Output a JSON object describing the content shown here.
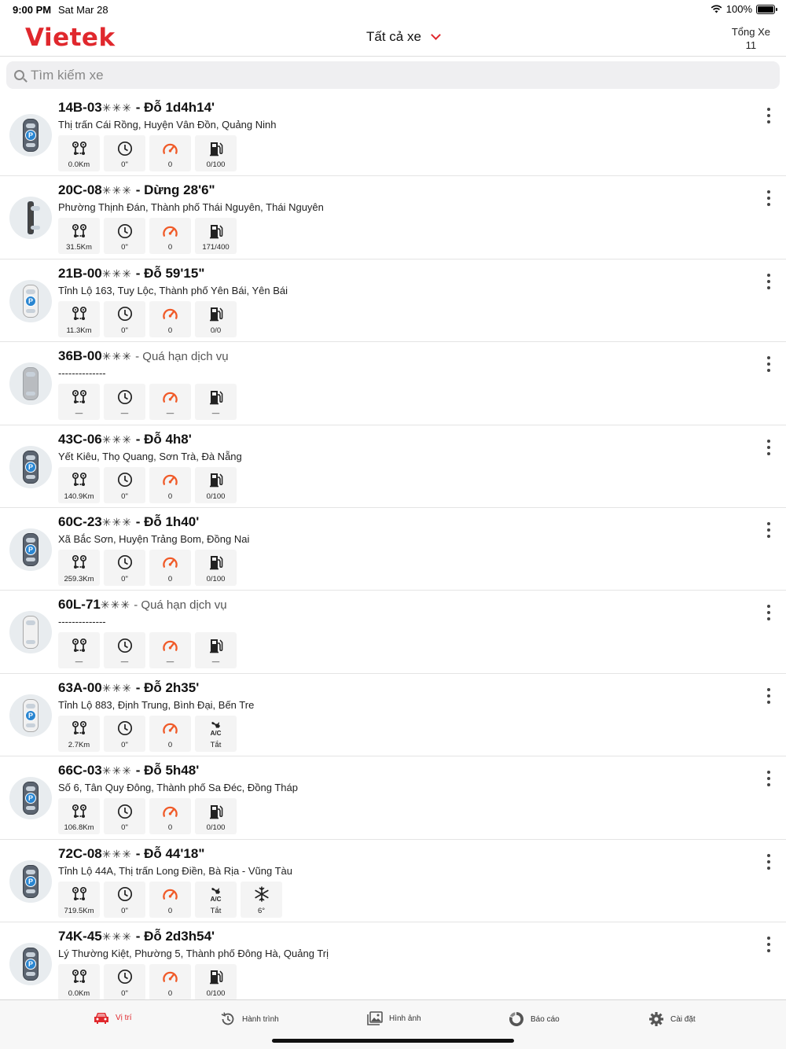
{
  "status_bar": {
    "time": "9:00 PM",
    "date": "Sat Mar 28",
    "battery": "100%"
  },
  "header": {
    "logo": "Vietek",
    "filter_label": "Tất cả xe",
    "total_label": "Tổng Xe",
    "total_count": "11"
  },
  "search": {
    "placeholder": "Tìm kiếm xe"
  },
  "vehicles": [
    {
      "plate": "14B-03",
      "stars": "✳✳✳",
      "status": " - Đỗ 1d4h14'",
      "address": "Thị trấn Cái Rồng, Huyện Vân Đồn, Quảng Ninh",
      "distance": "0.0Km",
      "time": "0\"",
      "speed": "0",
      "fourth": "0/100"
    },
    {
      "plate": "20C-08",
      "stars": "✳✳✳",
      "status": " - Dừng 28'6\"",
      "address": "Phường Thịnh Đán, Thành phố Thái Nguyên, Thái Nguyên",
      "distance": "31.5Km",
      "time": "0\"",
      "speed": "0",
      "fourth": "171/400"
    },
    {
      "plate": "21B-00",
      "stars": "✳✳✳",
      "status": " - Đỗ 59'15\"",
      "address": "Tỉnh Lộ 163, Tuy Lộc, Thành phố Yên Bái, Yên Bái",
      "distance": "11.3Km",
      "time": "0\"",
      "speed": "0",
      "fourth": "0/0"
    },
    {
      "plate": "36B-00",
      "stars": "✳✳✳",
      "status": " - Quá hạn dịch vụ",
      "address": "--------------",
      "distance": "—",
      "time": "—",
      "speed": "—",
      "fourth": "—"
    },
    {
      "plate": "43C-06",
      "stars": "✳✳✳",
      "status": " - Đỗ 4h8'",
      "address": "Yết Kiêu, Thọ Quang, Sơn Trà, Đà Nẵng",
      "distance": "140.9Km",
      "time": "0\"",
      "speed": "0",
      "fourth": "0/100"
    },
    {
      "plate": "60C-23",
      "stars": "✳✳✳",
      "status": " - Đỗ 1h40'",
      "address": "Xã Bắc Sơn, Huyện Trảng Bom, Đồng Nai",
      "distance": "259.3Km",
      "time": "0\"",
      "speed": "0",
      "fourth": "0/100"
    },
    {
      "plate": "60L-71",
      "stars": "✳✳✳",
      "status": " - Quá hạn dịch vụ",
      "address": "--------------",
      "distance": "—",
      "time": "—",
      "speed": "—",
      "fourth": "—"
    },
    {
      "plate": "63A-00",
      "stars": "✳✳✳",
      "status": " - Đỗ 2h35'",
      "address": "Tỉnh Lộ 883, Định Trung, Bình Đại, Bến Tre",
      "distance": "2.7Km",
      "time": "0\"",
      "speed": "0",
      "fourth": "Tắt"
    },
    {
      "plate": "66C-03",
      "stars": "✳✳✳",
      "status": " - Đỗ 5h48'",
      "address": "Số 6, Tân Quy Đông, Thành phố Sa Đéc, Đồng Tháp",
      "distance": "106.8Km",
      "time": "0\"",
      "speed": "0",
      "fourth": "0/100"
    },
    {
      "plate": "72C-08",
      "stars": "✳✳✳",
      "status": " - Đỗ 44'18\"",
      "address": "Tỉnh Lộ 44A, Thị trấn Long Điền, Bà Rịa - Vũng Tàu",
      "distance": "719.5Km",
      "time": "0\"",
      "speed": "0",
      "fourth": "Tắt",
      "fifth": "6°"
    },
    {
      "plate": "74K-45",
      "stars": "✳✳✳",
      "status": " - Đỗ 2d3h54'",
      "address": "Lý Thường Kiệt, Phường 5, Thành phố Đông Hà, Quảng Trị",
      "distance": "0.0Km",
      "time": "0\"",
      "speed": "0",
      "fourth": "0/100"
    }
  ],
  "ac_text": "A/C",
  "tabs": [
    {
      "label": "Vị trí"
    },
    {
      "label": "Hành trình"
    },
    {
      "label": "Hình ảnh"
    },
    {
      "label": "Báo cáo"
    },
    {
      "label": "Cài đặt"
    }
  ],
  "colors": {
    "brand": "#e0282d",
    "speed_icon": "#f05a28",
    "parking_badge": "#2a86d1"
  }
}
